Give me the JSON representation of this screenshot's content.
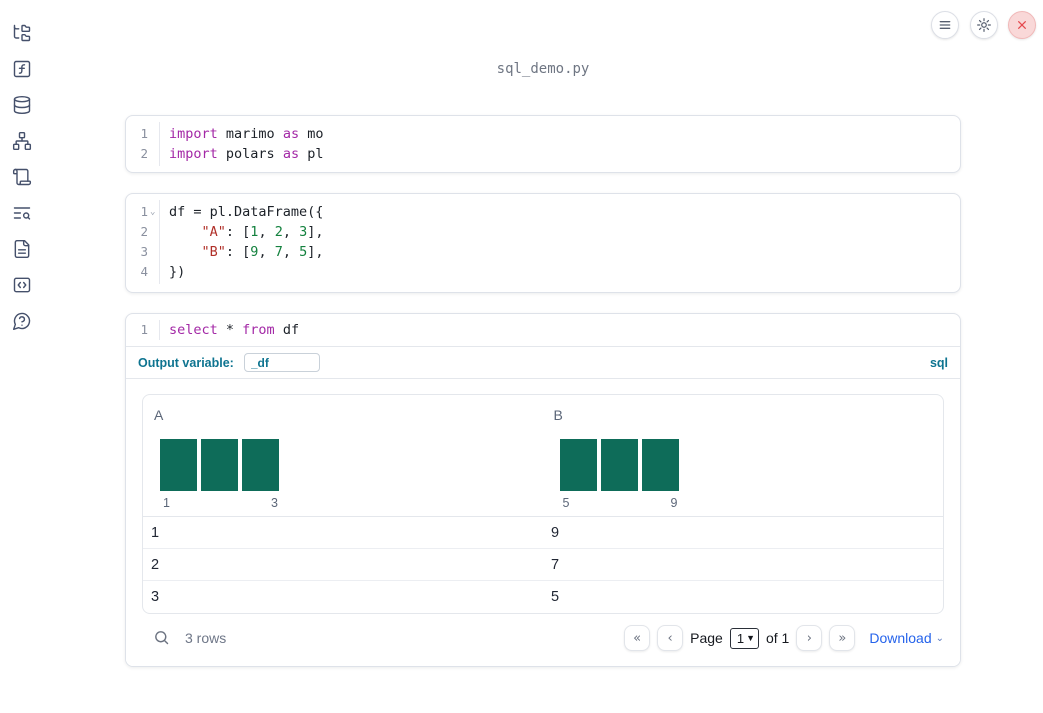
{
  "titlebar": {
    "filename": "sql_demo.py"
  },
  "topbar": {
    "icons": [
      "hamburger-menu-icon",
      "gear-icon",
      "close-icon"
    ]
  },
  "sidebar": {
    "icons": [
      "folder-tree-icon",
      "function-square-icon",
      "database-icon",
      "dependency-graph-icon",
      "scroll-logs-icon",
      "text-search-icon",
      "document-icon",
      "code-snippets-icon",
      "help-bubble-icon"
    ]
  },
  "cells": [
    {
      "name": "imports-cell",
      "lines": [
        {
          "num": "1",
          "tokens": [
            [
              "kw",
              "import"
            ],
            [
              "pl",
              " marimo "
            ],
            [
              "kw",
              "as"
            ],
            [
              "pl",
              " mo"
            ]
          ]
        },
        {
          "num": "2",
          "tokens": [
            [
              "kw",
              "import"
            ],
            [
              "pl",
              " polars "
            ],
            [
              "kw",
              "as"
            ],
            [
              "pl",
              " pl"
            ]
          ]
        }
      ]
    },
    {
      "name": "dataframe-cell",
      "lines": [
        {
          "num": "1",
          "fold": "⌄",
          "tokens": [
            [
              "pl",
              "df = pl.DataFrame({"
            ]
          ]
        },
        {
          "num": "2",
          "tokens": [
            [
              "pl",
              "    "
            ],
            [
              "str",
              "\"A\""
            ],
            [
              "pl",
              ": ["
            ],
            [
              "num",
              "1"
            ],
            [
              "pl",
              ", "
            ],
            [
              "num",
              "2"
            ],
            [
              "pl",
              ", "
            ],
            [
              "num",
              "3"
            ],
            [
              "pl",
              "],"
            ]
          ]
        },
        {
          "num": "3",
          "tokens": [
            [
              "pl",
              "    "
            ],
            [
              "str",
              "\"B\""
            ],
            [
              "pl",
              ": ["
            ],
            [
              "num",
              "9"
            ],
            [
              "pl",
              ", "
            ],
            [
              "num",
              "7"
            ],
            [
              "pl",
              ", "
            ],
            [
              "num",
              "5"
            ],
            [
              "pl",
              "],"
            ]
          ]
        },
        {
          "num": "4",
          "tokens": [
            [
              "pl",
              "})"
            ]
          ]
        }
      ]
    },
    {
      "name": "sql-cell",
      "lines": [
        {
          "num": "1",
          "tokens": [
            [
              "kw",
              "select"
            ],
            [
              "pl",
              " * "
            ],
            [
              "kw",
              "from"
            ],
            [
              "pl",
              " df"
            ]
          ]
        }
      ],
      "output_variable_label": "Output variable:",
      "output_variable_value": "_df",
      "language_badge": "sql"
    }
  ],
  "table": {
    "columns": [
      {
        "label": "A",
        "hist": {
          "type": "histogram",
          "bar_heights": [
            1,
            1,
            1
          ],
          "min_label": "1",
          "max_label": "3"
        }
      },
      {
        "label": "B",
        "hist": {
          "type": "histogram",
          "bar_heights": [
            1,
            1,
            1
          ],
          "min_label": "5",
          "max_label": "9"
        }
      }
    ],
    "rows": [
      [
        "1",
        "9"
      ],
      [
        "2",
        "7"
      ],
      [
        "3",
        "5"
      ]
    ],
    "footer": {
      "row_count": "3 rows",
      "first_page_glyph": "«",
      "prev_page_glyph": "‹",
      "next_page_glyph": "›",
      "last_page_glyph": "»",
      "page_label": "Page",
      "page_value": "1",
      "page_total": "of 1",
      "download_label": "Download"
    }
  },
  "colors": {
    "histogram_bar": "#0e6c59",
    "sql_accent": "#0e7490",
    "download_blue": "#2563eb",
    "shutdown_red": "#e5484d",
    "keyword": "#a328a6",
    "string": "#b02f28",
    "number": "#13813e"
  }
}
